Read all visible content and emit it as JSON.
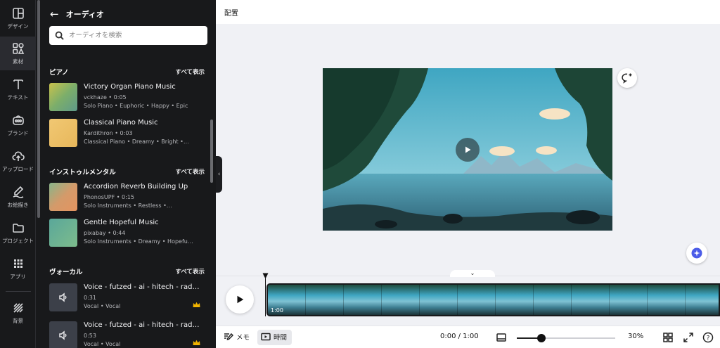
{
  "rail": {
    "items": [
      {
        "label": "デザイン",
        "icon": "layout-icon"
      },
      {
        "label": "素材",
        "icon": "elements-icon"
      },
      {
        "label": "テキスト",
        "icon": "text-icon"
      },
      {
        "label": "ブランド",
        "icon": "brand-icon"
      },
      {
        "label": "アップロード",
        "icon": "upload-cloud-icon"
      },
      {
        "label": "お絵描き",
        "icon": "draw-icon"
      },
      {
        "label": "プロジェクト",
        "icon": "folder-icon"
      },
      {
        "label": "アプリ",
        "icon": "apps-grid-icon"
      },
      {
        "label": "背景",
        "icon": "background-pattern-icon"
      }
    ]
  },
  "panel": {
    "title": "オーディオ",
    "search_placeholder": "オーディオを検索",
    "see_all": "すべて表示",
    "sections": [
      {
        "title": "ピアノ",
        "tracks": [
          {
            "name": "Victory Organ Piano Music",
            "meta": "vckhaze • 0:05",
            "tags": "Solo Piano • Euphoric • Happy • Epic",
            "thumb": "linear-gradient(135deg,#c9c24c,#7cae6a,#5e9a8a)"
          },
          {
            "name": "Classical Piano Music",
            "meta": "Kardithron • 0:03",
            "tags": "Classical Piano • Dreamy • Bright •…",
            "thumb": "linear-gradient(135deg,#f1c873,#e7b75b)"
          }
        ]
      },
      {
        "title": "インストゥルメンタル",
        "tracks": [
          {
            "name": "Accordion Reverb Building Up",
            "meta": "PhonosUPF • 0:15",
            "tags": "Solo Instruments • Restless •…",
            "thumb": "linear-gradient(135deg,#88b58a,#d49a6a,#e49460)"
          },
          {
            "name": "Gentle Hopeful Music",
            "meta": "pixabay • 0:44",
            "tags": "Solo Instruments • Dreamy • Hopefu…",
            "thumb": "linear-gradient(135deg,#5aa79a,#7dbc8c)"
          }
        ]
      },
      {
        "title": "ヴォーカル",
        "tracks": [
          {
            "name": "Voice - futzed - ai - hitech - radi…",
            "meta": "0:31",
            "tags": "Vocal • Vocal",
            "thumb": "audio"
          },
          {
            "name": "Voice - futzed - ai - hitech - radi…",
            "meta": "0:53",
            "tags": "Vocal • Vocal",
            "thumb": "audio"
          }
        ]
      }
    ]
  },
  "topbar": {
    "position_label": "配置"
  },
  "timeline": {
    "clip_duration": "1:00",
    "playhead_fraction": 0
  },
  "bottombar": {
    "notes_label": "メモ",
    "time_label": "時間",
    "time_display": "0:00 / 1:00",
    "zoom_percent": "30%",
    "zoom_value": 30,
    "help": "?"
  },
  "colors": {
    "rail_bg": "#18191b",
    "panel_bg": "#18191b",
    "canvas_bg": "#f0f1f5",
    "accent": "#7d2ae8"
  }
}
